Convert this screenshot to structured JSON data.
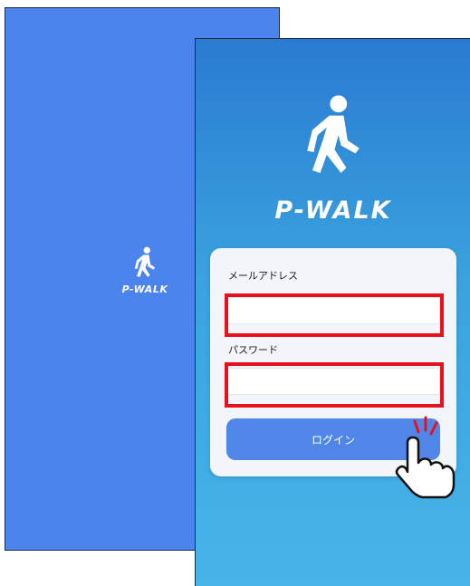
{
  "splash": {
    "brand": "P-WALK",
    "background_color": "#4a84ec",
    "icon": "walking-person-icon"
  },
  "login": {
    "brand": "P-WALK",
    "icon": "walking-person-icon",
    "email_label": "メールアドレス",
    "email_value": "",
    "password_label": "パスワード",
    "password_value": "",
    "login_button_label": "ログイン",
    "button_color": "#4f86e8",
    "highlight_color": "#e8101c",
    "pointer_icon": "tapping-hand-icon"
  }
}
